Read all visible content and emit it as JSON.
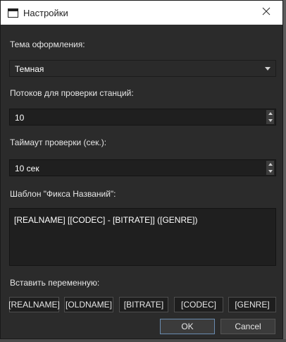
{
  "window": {
    "title": "Настройки"
  },
  "theme": {
    "label": "Тема оформления:",
    "value": "Темная"
  },
  "threads": {
    "label": "Потоков для проверки станций:",
    "value": "10"
  },
  "timeout": {
    "label": "Таймаут проверки (сек.):",
    "value": "10 сек"
  },
  "template": {
    "label": "Шаблон \"Фикса Названий\":",
    "value": "[REALNAME] [[CODEC] - [BITRATE]] ([GENRE])"
  },
  "variables": {
    "label": "Вставить переменную:",
    "buttons": [
      "[REALNAME]",
      "[OLDNAME]",
      "[BITRATE]",
      "[CODEC]",
      "[GENRE]"
    ]
  },
  "dialog": {
    "ok": "OK",
    "cancel": "Cancel"
  },
  "icons": {
    "app": "app-window-icon",
    "close": "close-icon"
  },
  "colors": {
    "background": "#2b2b2b",
    "field": "#1f1f1f",
    "text": "#e6e6e6",
    "ok_border": "#6a8cb0"
  }
}
